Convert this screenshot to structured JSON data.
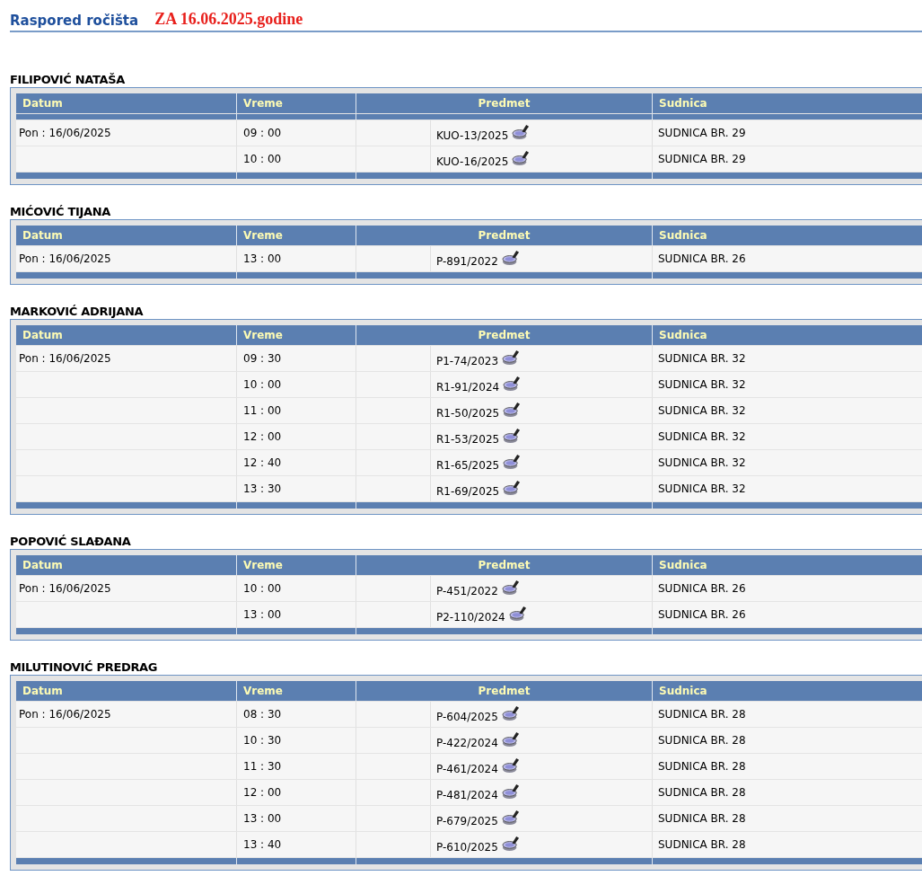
{
  "page_title": "Raspored ročišta",
  "date_heading": "ZA 16.06.2025.godine",
  "sections": [
    {
      "judge": "FILIPOVIĆ NATAŠA",
      "spacer_row": true,
      "columns": [
        "Datum",
        "Vreme",
        "Predmet",
        "Sudnica"
      ],
      "rows": [
        {
          "date": "Pon : 16/06/2025",
          "time": "09 : 00",
          "case": "KUO-13/2025",
          "courtroom": "SUDNICA BR. 29"
        },
        {
          "time": "10 : 00",
          "case": "KUO-16/2025",
          "courtroom": "SUDNICA BR. 29"
        }
      ]
    },
    {
      "judge": "MIĆOVIĆ TIJANA",
      "spacer_row": false,
      "columns": [
        "Datum",
        "Vreme",
        "Predmet",
        "Sudnica"
      ],
      "rows": [
        {
          "date": "Pon : 16/06/2025",
          "time": "13 : 00",
          "case": "P-891/2022",
          "courtroom": "SUDNICA BR. 26"
        }
      ]
    },
    {
      "judge": "MARKOVIĆ ADRIJANA",
      "spacer_row": false,
      "columns": [
        "Datum",
        "Vreme",
        "Predmet",
        "Sudnica"
      ],
      "rows": [
        {
          "date": "Pon : 16/06/2025",
          "time": "09 : 30",
          "case": "P1-74/2023",
          "courtroom": "SUDNICA BR. 32"
        },
        {
          "time": "10 : 00",
          "case": "R1-91/2024",
          "courtroom": "SUDNICA BR. 32"
        },
        {
          "time": "11 : 00",
          "case": "R1-50/2025",
          "courtroom": "SUDNICA BR. 32"
        },
        {
          "time": "12 : 00",
          "case": "R1-53/2025",
          "courtroom": "SUDNICA BR. 32"
        },
        {
          "time": "12 : 40",
          "case": "R1-65/2025",
          "courtroom": "SUDNICA BR. 32"
        },
        {
          "time": "13 : 30",
          "case": "R1-69/2025",
          "courtroom": "SUDNICA BR. 32"
        }
      ]
    },
    {
      "judge": "POPOVIĆ SLAĐANA",
      "spacer_row": false,
      "columns": [
        "Datum",
        "Vreme",
        "Predmet",
        "Sudnica"
      ],
      "rows": [
        {
          "date": "Pon : 16/06/2025",
          "time": "10 : 00",
          "case": "P-451/2022",
          "courtroom": "SUDNICA BR. 26"
        },
        {
          "time": "13 : 00",
          "case": "P2-110/2024",
          "courtroom": "SUDNICA BR. 26"
        }
      ]
    },
    {
      "judge": "MILUTINOVIĆ PREDRAG",
      "spacer_row": false,
      "columns": [
        "Datum",
        "Vreme",
        "Predmet",
        "Sudnica"
      ],
      "rows": [
        {
          "date": "Pon : 16/06/2025",
          "time": "08 : 30",
          "case": "P-604/2025",
          "courtroom": "SUDNICA BR. 28"
        },
        {
          "time": "10 : 30",
          "case": "P-422/2024",
          "courtroom": "SUDNICA BR. 28"
        },
        {
          "time": "11 : 30",
          "case": "P-461/2024",
          "courtroom": "SUDNICA BR. 28"
        },
        {
          "time": "12 : 00",
          "case": "P-481/2024",
          "courtroom": "SUDNICA BR. 28"
        },
        {
          "time": "13 : 00",
          "case": "P-679/2025",
          "courtroom": "SUDNICA BR. 28"
        },
        {
          "time": "13 : 40",
          "case": "P-610/2025",
          "courtroom": "SUDNICA BR. 28"
        }
      ]
    }
  ]
}
